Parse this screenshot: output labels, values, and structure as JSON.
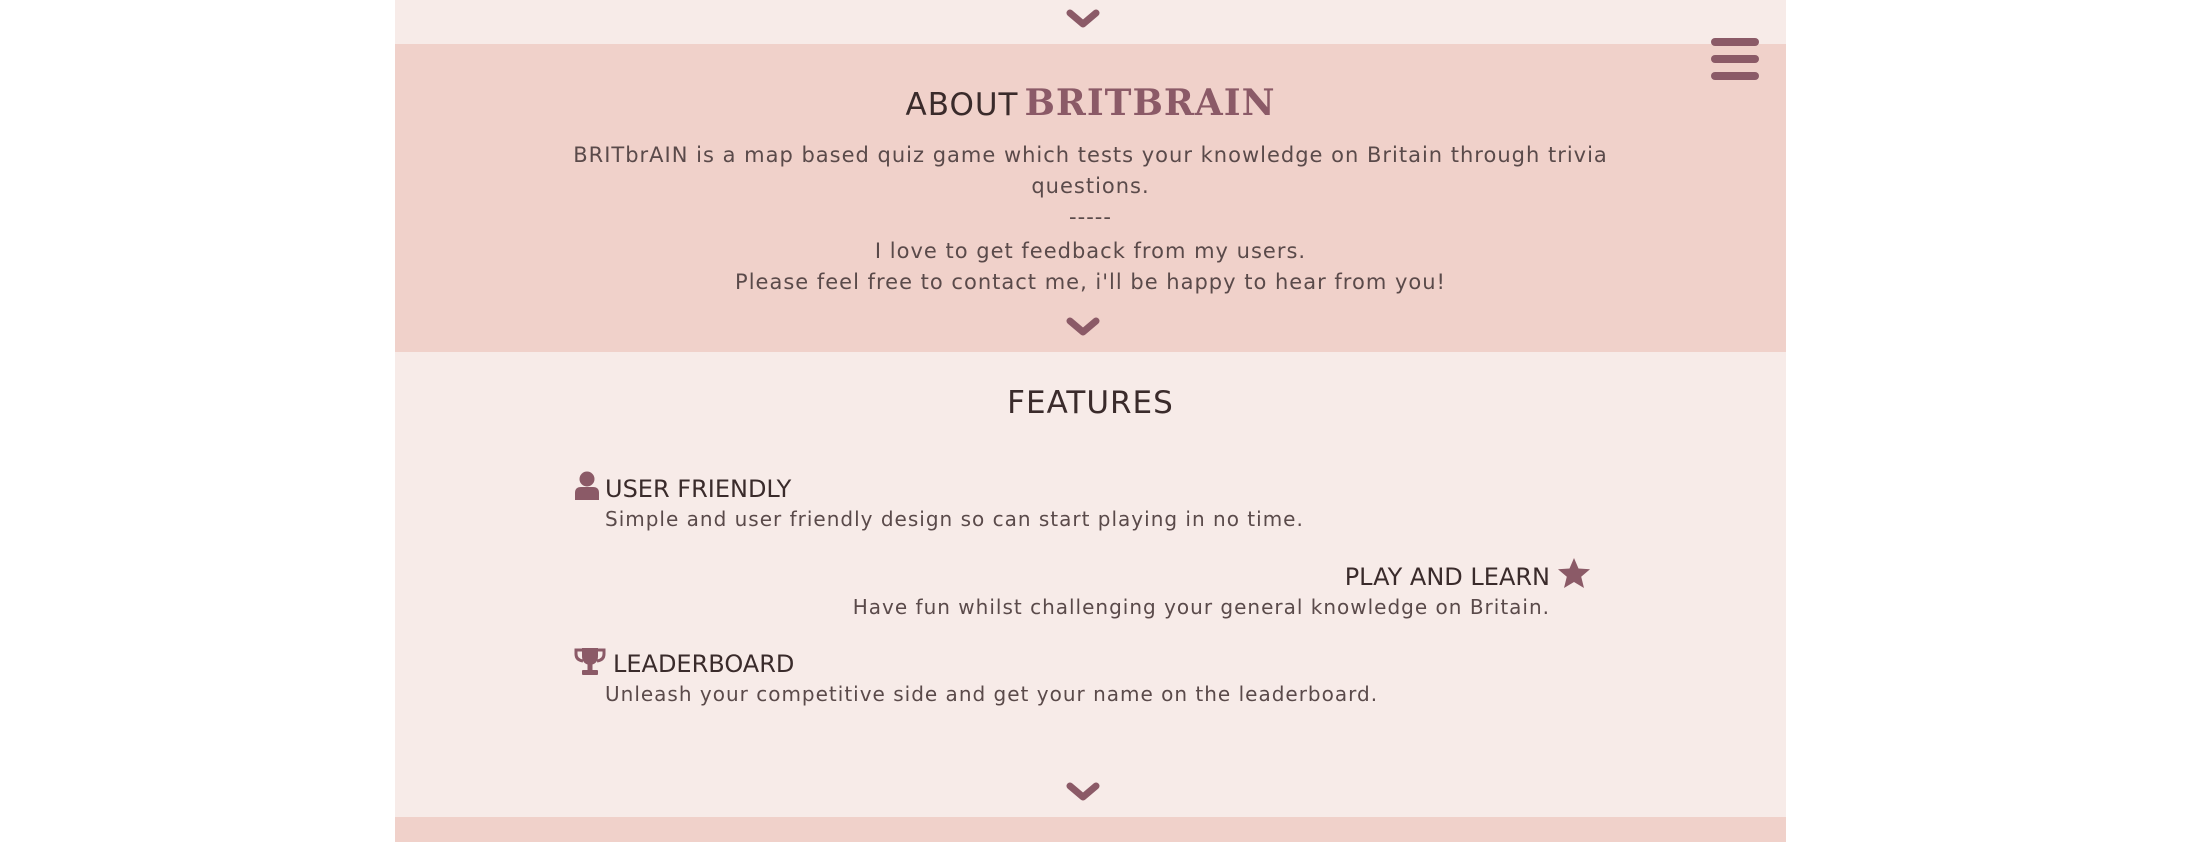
{
  "header": {
    "menu_icon": "hamburger-menu-icon"
  },
  "about": {
    "title_prefix": "ABOUT",
    "title_brand": "BRITBRAIN",
    "description_line1": "BRITbrAIN is a map based quiz game which tests your knowledge on Britain through trivia",
    "description_line2": "questions.",
    "separator": "-----",
    "feedback_line1": "I love to get feedback from my users.",
    "feedback_line2": "Please feel free to contact me, i'll be happy to hear from you!"
  },
  "features": {
    "title": "FEATURES",
    "items": [
      {
        "icon": "user-icon",
        "heading": "USER FRIENDLY",
        "description": "Simple and user friendly design so can start playing in no time."
      },
      {
        "icon": "star-icon",
        "heading": "PLAY AND LEARN",
        "description": "Have fun whilst challenging your general knowledge on Britain."
      },
      {
        "icon": "trophy-icon",
        "heading": "LEADERBOARD",
        "description": "Unleash your competitive side and get your name on the leaderboard."
      }
    ]
  },
  "colors": {
    "accent": "#8b5a67",
    "light_band": "#f7ebe8",
    "dark_band": "#f0d1ca",
    "heading_text": "#3a2b2b",
    "body_text": "#5a4a4a"
  }
}
